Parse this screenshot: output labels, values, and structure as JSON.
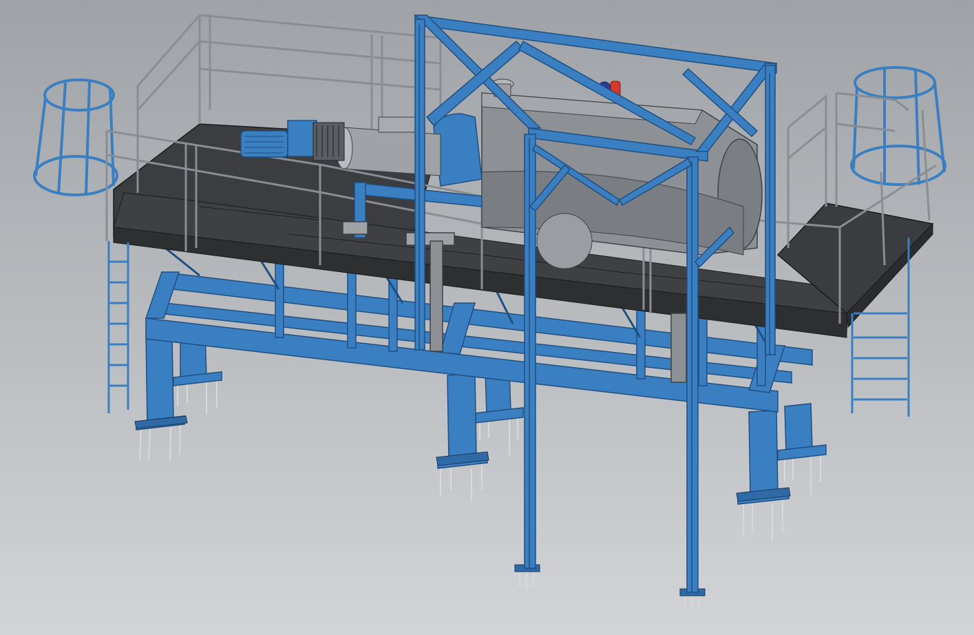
{
  "viewport": {
    "background_top": "#9fa2a6",
    "background_bottom": "#d2d4d7"
  },
  "model": {
    "steel_color": "#3a7fc1",
    "steel_dark": "#1f4f80",
    "deck_color": "#3b3d40",
    "equipment_color": "#8d9094",
    "valve_color": "#d23a2a",
    "valve_secondary": "#2a3a9a",
    "components": [
      "decanter-centrifuge",
      "drive-motor",
      "gearbox",
      "platform-deck",
      "handrails",
      "cage-ladder-left",
      "cage-ladder-right",
      "hoist-frame",
      "support-legs",
      "anchor-bolts",
      "valve"
    ]
  }
}
